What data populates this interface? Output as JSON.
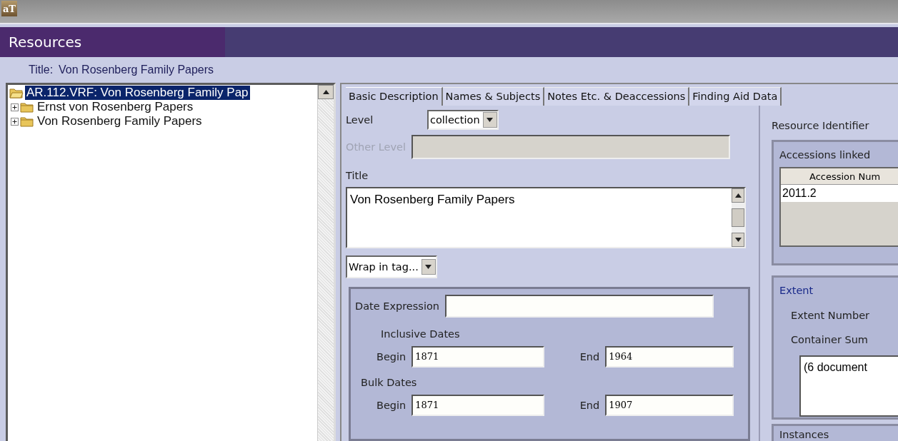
{
  "window": {
    "logo": "aT"
  },
  "header": {
    "title": "Resources"
  },
  "record_title": {
    "label": "Title:",
    "value": "Von Rosenberg Family Papers"
  },
  "tree": [
    {
      "label": "AR.112.VRF: Von Rosenberg Family Pap",
      "selected": true,
      "expanded": true,
      "children": [
        {
          "label": "Ernst von Rosenberg Papers",
          "selected": false,
          "expanded": false
        },
        {
          "label": "Von Rosenberg Family Papers",
          "selected": false,
          "expanded": false
        }
      ]
    }
  ],
  "tabs": [
    {
      "label": "Basic Description",
      "selected": true
    },
    {
      "label": "Names & Subjects",
      "selected": false
    },
    {
      "label": "Notes Etc. & Deaccessions",
      "selected": false
    },
    {
      "label": "Finding Aid Data",
      "selected": false
    }
  ],
  "basic": {
    "level": {
      "label": "Level",
      "value": "collection"
    },
    "other_level": {
      "label": "Other Level",
      "disabled": true
    },
    "title": {
      "label": "Title",
      "value": "Von Rosenberg Family Papers"
    },
    "wrap_tag": {
      "value": "Wrap in tag..."
    },
    "date_expression": {
      "label": "Date Expression"
    },
    "date_groups": [
      {
        "label": "Inclusive Dates",
        "begin_label": "Begin",
        "begin": "1871",
        "end_label": "End",
        "end": "1964"
      },
      {
        "label": "Bulk Dates",
        "begin_label": "Begin",
        "begin": "1871",
        "end_label": "End",
        "end": "1907"
      }
    ]
  },
  "side": {
    "resource_identifier": "Resource Identifier",
    "accessions": {
      "title": "Accessions linked",
      "columns": [
        "Accession Num"
      ],
      "rows": [
        "2011.2"
      ]
    },
    "extent": {
      "title": "Extent",
      "extent_number_label": "Extent Number",
      "container_summary_label": "Container Sum",
      "container_summary": "(6 document"
    },
    "instances": {
      "title": "Instances"
    }
  }
}
